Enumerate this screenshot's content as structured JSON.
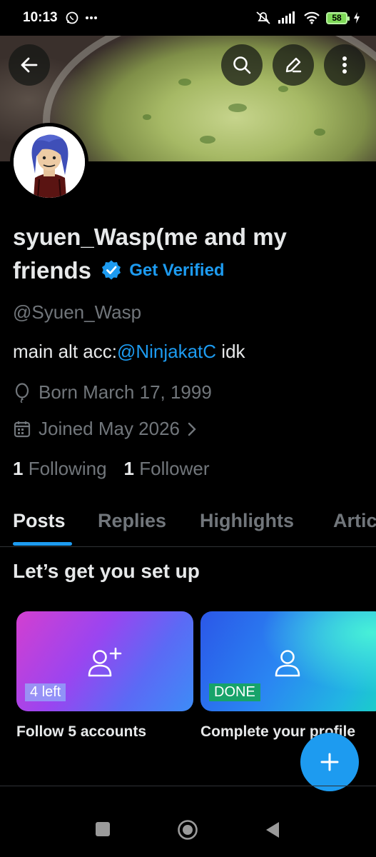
{
  "status_bar": {
    "time": "10:13",
    "battery": "58"
  },
  "toolbar": {
    "back_icon": "arrow-left-icon",
    "search_icon": "search-icon",
    "edit_icon": "pencil-icon",
    "more_icon": "more-vertical-icon"
  },
  "profile": {
    "display_name": "syuen_Wasp(me and my friends",
    "get_verified": "Get Verified",
    "handle": "@Syuen_Wasp",
    "bio_prefix": "main alt acc:",
    "bio_mention": "@NinjakatC",
    "bio_suffix": " idk",
    "born": "Born March 17, 1999",
    "joined": "Joined May 2026",
    "following_count": "1",
    "following_label": "Following",
    "followers_count": "1",
    "followers_label": "Follower"
  },
  "tabs": [
    {
      "label": "Posts",
      "active": true
    },
    {
      "label": "Replies",
      "active": false
    },
    {
      "label": "Highlights",
      "active": false
    },
    {
      "label": "Artic",
      "active": false
    }
  ],
  "setup": {
    "title": "Let’s get you set up",
    "cards": [
      {
        "badge": "4 left",
        "caption": "Follow 5 accounts",
        "icon": "add-user-icon"
      },
      {
        "badge": "DONE",
        "caption": "Complete your profile",
        "icon": "user-icon"
      }
    ]
  },
  "colors": {
    "accent": "#1d9bf0",
    "background": "#000000",
    "muted_text": "#71767b",
    "done_badge": "#17a36a"
  }
}
